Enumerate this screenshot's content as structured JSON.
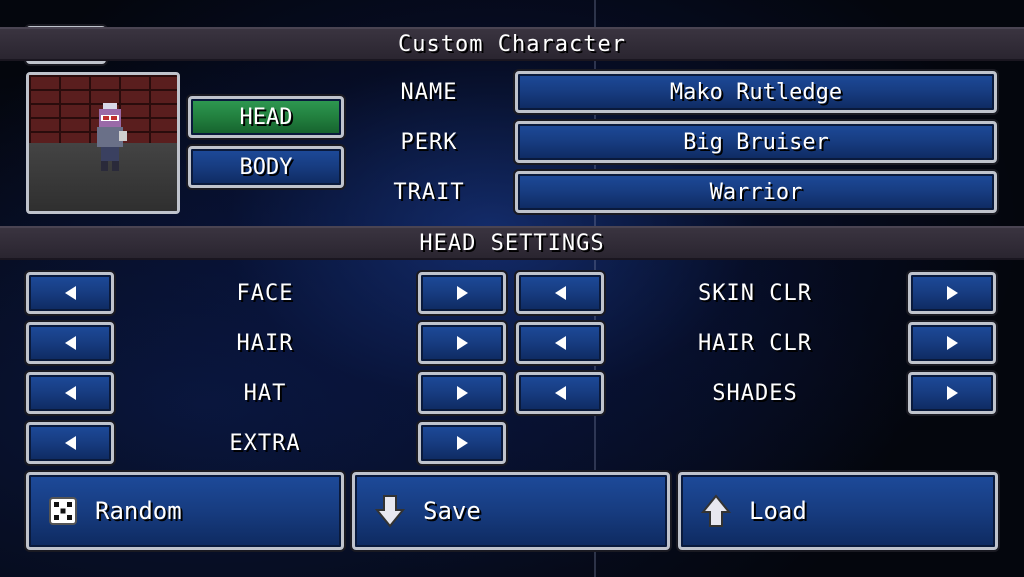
{
  "header": {
    "title": "Custom Character"
  },
  "tabs": [
    {
      "label": "HEAD",
      "active": true
    },
    {
      "label": "BODY",
      "active": false
    }
  ],
  "info_rows": [
    {
      "label": "NAME",
      "value": "Mako Rutledge"
    },
    {
      "label": "PERK",
      "value": "Big Bruiser"
    },
    {
      "label": "TRAIT",
      "value": "Warrior"
    }
  ],
  "settings": {
    "title": "HEAD SETTINGS",
    "left": [
      "FACE",
      "HAIR",
      "HAT",
      "EXTRA"
    ],
    "right": [
      "SKIN CLR",
      "HAIR CLR",
      "SHADES"
    ]
  },
  "actions": {
    "random": "Random",
    "save": "Save",
    "load": "Load"
  },
  "colors": {
    "button_blue": "#1d4a9a",
    "active_green": "#2f9a52",
    "bar": "#3a3440"
  }
}
